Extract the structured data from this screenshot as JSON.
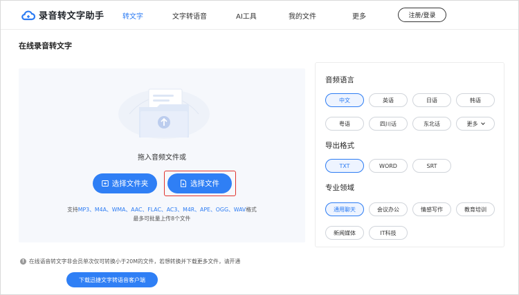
{
  "app": {
    "title": "录音转文字助手"
  },
  "nav": {
    "items": [
      {
        "label": "转文字",
        "active": true
      },
      {
        "label": "文字转语音",
        "active": false
      },
      {
        "label": "AI工具",
        "active": false
      },
      {
        "label": "我的文件",
        "active": false
      },
      {
        "label": "更多",
        "active": false
      }
    ],
    "login_label": "注册/登录"
  },
  "page": {
    "title": "在线录音转文字"
  },
  "upload": {
    "drop_hint": "拖入音频文件或",
    "folder_button": "选择文件夹",
    "file_button": "选择文件",
    "formats_prefix": "支持",
    "formats_list": "MP3、M4A、WMA、AAC、FLAC、AC3、M4R、APE、OGG、WAV",
    "formats_suffix": "格式",
    "limit_text": "最多可批量上传8个文件"
  },
  "notice": {
    "text": "在线语音转文字非会员单次仅可转换小于20M的文件，若想转换并下载更多文件，请开通",
    "download_button": "下载迅捷文字转语音客户端"
  },
  "settings": {
    "language": {
      "title": "音频语言",
      "options": [
        "中文",
        "英语",
        "日语",
        "韩语",
        "粤语",
        "四川话",
        "东北话",
        "更多"
      ],
      "selected": "中文"
    },
    "export": {
      "title": "导出格式",
      "options": [
        "TXT",
        "WORD",
        "SRT"
      ],
      "selected": "TXT"
    },
    "domain": {
      "title": "专业领域",
      "options": [
        "通用聊天",
        "会议办公",
        "情感写作",
        "教育培训",
        "新闻媒体",
        "IT科技"
      ],
      "selected": "通用聊天"
    }
  },
  "colors": {
    "accent": "#2f7ff5",
    "highlight_border": "#e0312b",
    "panel_bg": "#f6f8fc"
  }
}
